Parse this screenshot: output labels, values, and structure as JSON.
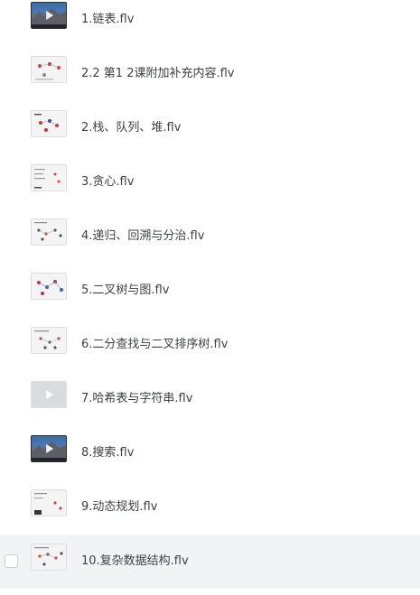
{
  "files": [
    {
      "name": "1.链表.flv",
      "thumb": "dark-video"
    },
    {
      "name": "2.2 第1 2课附加补充内容.flv",
      "thumb": "slide-graph"
    },
    {
      "name": "2.栈、队列、堆.flv",
      "thumb": "slide-graph"
    },
    {
      "name": "3.贪心.flv",
      "thumb": "slide-text"
    },
    {
      "name": "4.递归、回溯与分治.flv",
      "thumb": "slide-graph"
    },
    {
      "name": "5.二叉树与图.flv",
      "thumb": "slide-graph"
    },
    {
      "name": "6.二分查找与二叉排序树.flv",
      "thumb": "slide-graph"
    },
    {
      "name": "7.哈希表与字符串.flv",
      "thumb": "gray-video"
    },
    {
      "name": "8.搜索.flv",
      "thumb": "dark-video"
    },
    {
      "name": "9.动态规划.flv",
      "thumb": "slide-graph"
    },
    {
      "name": "10.复杂数据结构.flv",
      "thumb": "slide-graph"
    }
  ],
  "hovered_index": 10
}
